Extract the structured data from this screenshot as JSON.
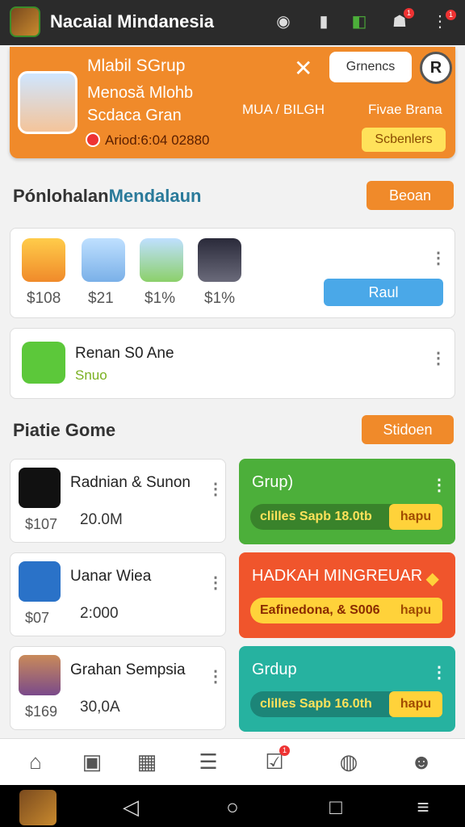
{
  "topbar": {
    "title": "Nacaial Mindanesia",
    "badge1": "1",
    "badge2": "1"
  },
  "profile": {
    "name": "Mlabil SGrup",
    "line2": "Menosă Mlohb",
    "line3": "Scdaca Gran",
    "location": "MUA / BILGH",
    "fave": "Fivae Brana",
    "time": "Ariod:6:04 02880",
    "gm_label": "Grnencs",
    "r_label": "R",
    "schedule_label": "Scbenlers"
  },
  "friends": {
    "title_a": "Pónlohalan",
    "title_b": "Mendalaun",
    "btn_label": "Beoan",
    "amounts": [
      "$108",
      "$21",
      "$1%",
      "$1%"
    ],
    "raul_label": "Raul"
  },
  "featured": {
    "name": "Renan S0 Ane",
    "sub": "Snuo"
  },
  "games": {
    "title": "Piatie Gome",
    "btn_label": "Stidoen",
    "items": [
      {
        "name": "Radnian & Sunon",
        "price": "$107",
        "badge": "20.0M"
      },
      {
        "name": "Uanar Wiea",
        "price": "$07",
        "badge": "2:000"
      },
      {
        "name": "Grahan Sempsia",
        "price": "$169",
        "badge": "30,0A"
      }
    ],
    "promos": [
      {
        "title": "Grup)",
        "bar": "clilles Sapb 18.0tb",
        "action": "hapu",
        "color": "#4caf3a"
      },
      {
        "title": "HADKAH MINGREUAR",
        "bar": "Eafinedona, & S006",
        "action": "hapu",
        "color": "#f0552c"
      },
      {
        "title": "Grdup",
        "bar": "clilles Sapb 16.0th",
        "action": "hapu",
        "color": "#26b2a0"
      }
    ]
  },
  "nav": {
    "badge": "1"
  }
}
